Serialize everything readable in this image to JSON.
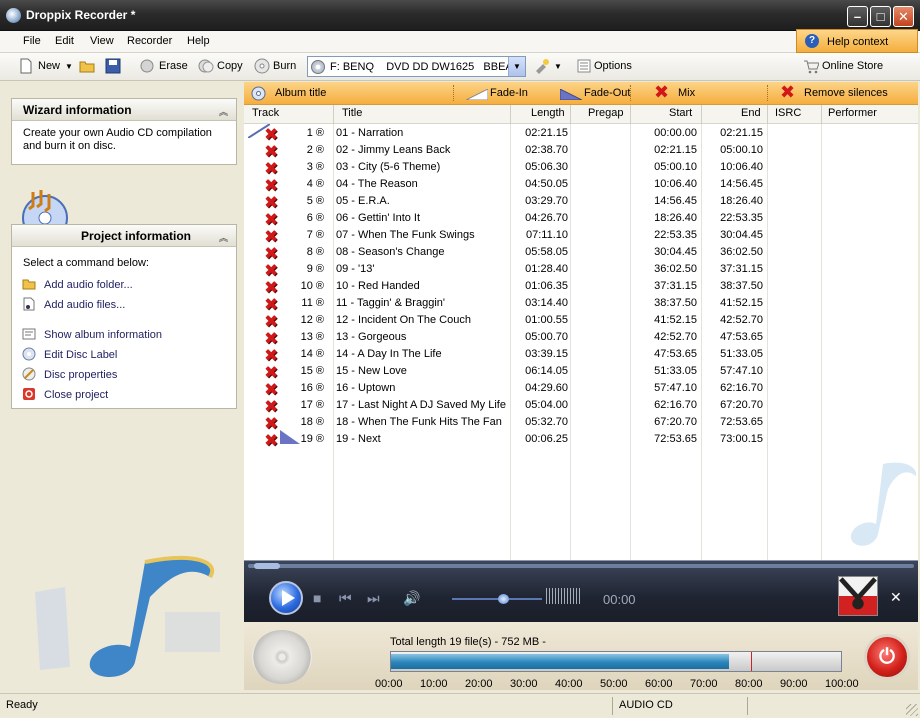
{
  "window": {
    "title": "Droppix Recorder *"
  },
  "menu": {
    "items": [
      "File",
      "Edit",
      "View",
      "Recorder",
      "Help"
    ],
    "help_context": "Help context"
  },
  "toolbar": {
    "new": "New",
    "erase": "Erase",
    "copy": "Copy",
    "burn": "Burn",
    "drive": "F: BENQ    DVD DD DW1625   BBEA",
    "options": "Options",
    "online_store": "Online Store"
  },
  "wizard": {
    "title": "Wizard information",
    "text": "Create your own Audio CD compilation and burn it on disc."
  },
  "project": {
    "title": "Project information",
    "intro": "Select a command below:",
    "links": [
      "Add audio folder...",
      "Add audio files...",
      "Show album information",
      "Edit Disc Label",
      "Disc properties",
      "Close project"
    ]
  },
  "panel": {
    "album_title": "Album title",
    "fade_in": "Fade-In",
    "fade_out": "Fade-Out",
    "mix": "Mix",
    "remove_silences": "Remove silences"
  },
  "columns": {
    "track": "Track",
    "title": "Title",
    "length": "Length",
    "pregap": "Pregap",
    "start": "Start",
    "end": "End",
    "isrc": "ISRC",
    "performer": "Performer"
  },
  "tracks": [
    {
      "track": "1 ®",
      "title": "01 - Narration",
      "length": "02:21.15",
      "start": "00:00.00",
      "end": "02:21.15"
    },
    {
      "track": "2 ®",
      "title": "02 - Jimmy Leans Back",
      "length": "02:38.70",
      "start": "02:21.15",
      "end": "05:00.10"
    },
    {
      "track": "3 ®",
      "title": "03 - City (5-6 Theme)",
      "length": "05:06.30",
      "start": "05:00.10",
      "end": "10:06.40"
    },
    {
      "track": "4 ®",
      "title": "04 - The Reason",
      "length": "04:50.05",
      "start": "10:06.40",
      "end": "14:56.45"
    },
    {
      "track": "5 ®",
      "title": "05 - E.R.A.",
      "length": "03:29.70",
      "start": "14:56.45",
      "end": "18:26.40"
    },
    {
      "track": "6 ®",
      "title": "06 - Gettin' Into It",
      "length": "04:26.70",
      "start": "18:26.40",
      "end": "22:53.35"
    },
    {
      "track": "7 ®",
      "title": "07 - When The Funk Swings",
      "length": "07:11.10",
      "start": "22:53.35",
      "end": "30:04.45"
    },
    {
      "track": "8 ®",
      "title": "08 - Season's Change",
      "length": "05:58.05",
      "start": "30:04.45",
      "end": "36:02.50"
    },
    {
      "track": "9 ®",
      "title": "09 - '13'",
      "length": "01:28.40",
      "start": "36:02.50",
      "end": "37:31.15"
    },
    {
      "track": "10 ®",
      "title": "10 - Red Handed",
      "length": "01:06.35",
      "start": "37:31.15",
      "end": "38:37.50"
    },
    {
      "track": "11 ®",
      "title": "11 - Taggin' & Braggin'",
      "length": "03:14.40",
      "start": "38:37.50",
      "end": "41:52.15"
    },
    {
      "track": "12 ®",
      "title": "12 - Incident On The Couch",
      "length": "01:00.55",
      "start": "41:52.15",
      "end": "42:52.70"
    },
    {
      "track": "13 ®",
      "title": "13 - Gorgeous",
      "length": "05:00.70",
      "start": "42:52.70",
      "end": "47:53.65"
    },
    {
      "track": "14 ®",
      "title": "14 - A Day In The Life",
      "length": "03:39.15",
      "start": "47:53.65",
      "end": "51:33.05"
    },
    {
      "track": "15 ®",
      "title": "15 - New Love",
      "length": "06:14.05",
      "start": "51:33.05",
      "end": "57:47.10"
    },
    {
      "track": "16 ®",
      "title": "16 - Uptown",
      "length": "04:29.60",
      "start": "57:47.10",
      "end": "62:16.70"
    },
    {
      "track": "17 ®",
      "title": "17 - Last Night A DJ Saved My Life",
      "length": "05:04.00",
      "start": "62:16.70",
      "end": "67:20.70"
    },
    {
      "track": "18 ®",
      "title": "18 - When The Funk Hits The Fan",
      "length": "05:32.70",
      "start": "67:20.70",
      "end": "72:53.65"
    },
    {
      "track": "19 ®",
      "title": "19 - Next",
      "length": "00:06.25",
      "start": "72:53.65",
      "end": "73:00.15"
    }
  ],
  "player": {
    "time": "00:00"
  },
  "capacity": {
    "label": "Total length 19 file(s) - 752 MB -",
    "fill_fraction": 0.75,
    "ticks": [
      "00:00",
      "10:00",
      "20:00",
      "30:00",
      "40:00",
      "50:00",
      "60:00",
      "70:00",
      "80:00",
      "90:00",
      "100:00"
    ]
  },
  "status": {
    "left": "Ready",
    "mode": "AUDIO CD"
  }
}
